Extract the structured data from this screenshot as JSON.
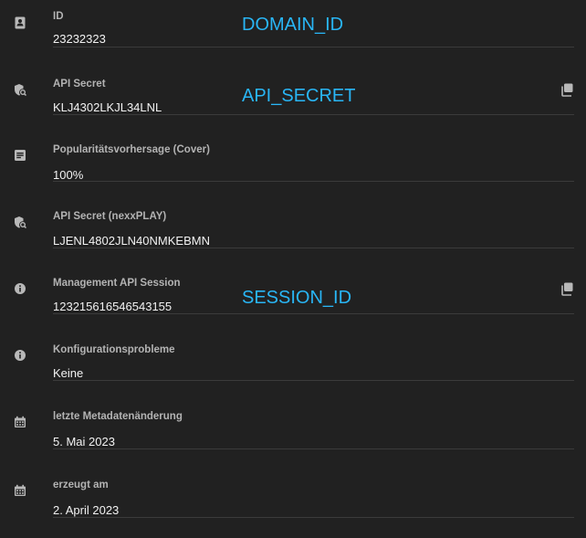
{
  "fields": [
    {
      "label": "ID",
      "value": "23232323",
      "icon": "contact-card-icon"
    },
    {
      "label": "API Secret",
      "value": "KLJ4302LKJL34LNL",
      "icon": "key-shield-icon"
    },
    {
      "label": "Popularitätsvorhersage (Cover)",
      "value": "100%",
      "icon": "notes-icon"
    },
    {
      "label": "API Secret (nexxPLAY)",
      "value": "LJENL4802JLN40NMKEBMN",
      "icon": "key-shield-icon"
    },
    {
      "label": "Management API Session",
      "value": "123215616546543155",
      "icon": "info-icon"
    },
    {
      "label": "Konfigurationsprobleme",
      "value": "Keine",
      "icon": "info-icon"
    },
    {
      "label": "letzte Metadatenänderung",
      "value": "5. Mai 2023",
      "icon": "calendar-icon"
    },
    {
      "label": "erzeugt am",
      "value": "2. April 2023",
      "icon": "calendar-icon"
    }
  ],
  "overlays": {
    "domain_id": "DOMAIN_ID",
    "api_secret": "API_SECRET",
    "session_id": "SESSION_ID"
  },
  "colors": {
    "background": "#212121",
    "label": "#b3b3b3",
    "value": "#f2f2f2",
    "icon": "#b8b8b8",
    "overlay": "#29b6f6",
    "divider": "#3b3b3b"
  }
}
